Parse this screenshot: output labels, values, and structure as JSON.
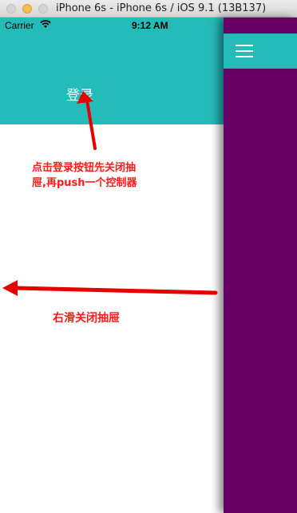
{
  "window": {
    "title": "iPhone 6s - iPhone 6s / iOS 9.1 (13B137)"
  },
  "status_bar": {
    "carrier": "Carrier",
    "time": "9:12 AM",
    "wifi_icon": "wifi-icon",
    "battery_icon": "battery-icon"
  },
  "menu": {
    "login_label": "登录",
    "header_color": "#25bbb8",
    "body_color": "#ffffff"
  },
  "main": {
    "background_color": "#660066",
    "nav_color": "#25bbb8",
    "menu_icon": "hamburger-menu-icon"
  },
  "annotations": {
    "login_note_line1": "点击登录按钮先关闭抽",
    "login_note_line2": "屉,再push一个控制器",
    "swipe_note": "右滑关闭抽屉",
    "color": "#ff1a1a"
  }
}
